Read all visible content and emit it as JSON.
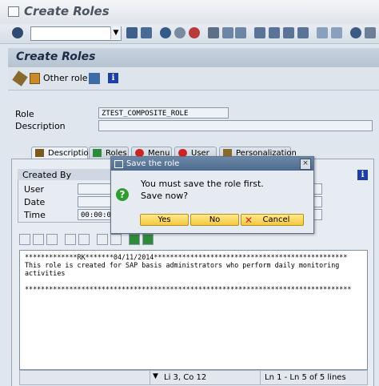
{
  "window": {
    "title": "Create Roles"
  },
  "header": {
    "title": "Create Roles",
    "other_role": "Other role"
  },
  "form": {
    "role_label": "Role",
    "role_value": "ZTEST_COMPOSITE_ROLE",
    "description_label": "Description",
    "description_value": ""
  },
  "tabs": [
    {
      "label": "Description",
      "icon": "description-icon",
      "active": true
    },
    {
      "label": "Roles",
      "icon": "roles-icon"
    },
    {
      "label": "Menu",
      "icon": "menu-icon"
    },
    {
      "label": "User",
      "icon": "user-icon"
    },
    {
      "label": "Personalization",
      "icon": "personalization-icon"
    }
  ],
  "created_by": {
    "title": "Created By",
    "user_label": "User",
    "date_label": "Date",
    "time_label": "Time",
    "time_value": "00:00:0"
  },
  "editor": {
    "lines": [
      "*************RK*******04/11/2014************************************************",
      "This role is created for SAP basis administrators who perform daily monitoring",
      "activities",
      "",
      "*********************************************************************************"
    ],
    "cursor": "Li 3, Co 12",
    "lines_info": "Ln 1 - Ln 5 of 5 lines"
  },
  "dialog": {
    "title": "Save the role",
    "message1": "You must save the role first.",
    "message2": "Save now?",
    "yes": "Yes",
    "no": "No",
    "cancel": "Cancel"
  },
  "colors": {
    "accent": "#1d3fa6",
    "button_yellow": "#f3c842",
    "title_bar": "#4e6a8c",
    "question_icon": "#2e9d2e",
    "cancel_x": "#d42020"
  }
}
